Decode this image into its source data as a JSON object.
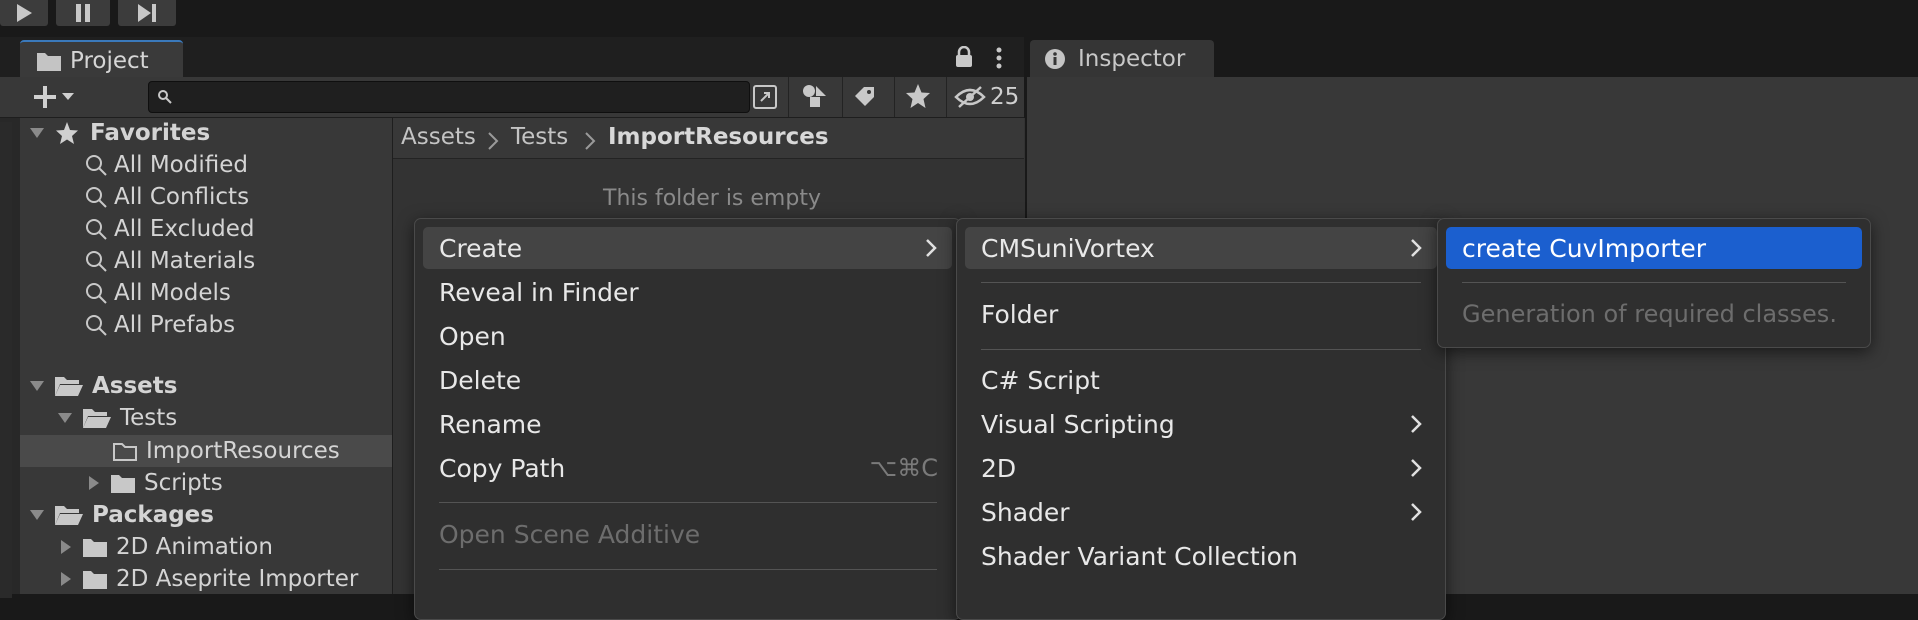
{
  "project_tab": {
    "label": "Project"
  },
  "inspector_tab": {
    "label": "Inspector"
  },
  "hidden_count": "25",
  "search": {
    "placeholder": ""
  },
  "favorites": {
    "label": "Favorites",
    "items": [
      "All Modified",
      "All Conflicts",
      "All Excluded",
      "All Materials",
      "All Models",
      "All Prefabs"
    ]
  },
  "assets": {
    "label": "Assets",
    "tests": "Tests",
    "import_resources": "ImportResources",
    "scripts": "Scripts"
  },
  "packages": {
    "label": "Packages",
    "items": [
      "2D Animation",
      "2D Aseprite Importer"
    ]
  },
  "breadcrumb": {
    "root": "Assets",
    "mid": "Tests",
    "current": "ImportResources"
  },
  "empty_message": "This folder is empty",
  "context_menu": {
    "create": "Create",
    "reveal": "Reveal in Finder",
    "open": "Open",
    "delete": "Delete",
    "rename": "Rename",
    "copy_path": "Copy Path",
    "copy_path_shortcut": "⌥⌘C",
    "open_scene_additive": "Open Scene Additive"
  },
  "create_menu": {
    "cmsuni": "CMSuniVortex",
    "folder": "Folder",
    "csharp": "C# Script",
    "visual_scripting": "Visual Scripting",
    "two_d": "2D",
    "shader": "Shader",
    "shader_variant": "Shader Variant Collection"
  },
  "cms_menu": {
    "create_importer": "create CuvImporter",
    "description": "Generation of required classes."
  },
  "colors": {
    "accent": "#1b5fcf",
    "tab_highlight": "#3a79bb"
  }
}
